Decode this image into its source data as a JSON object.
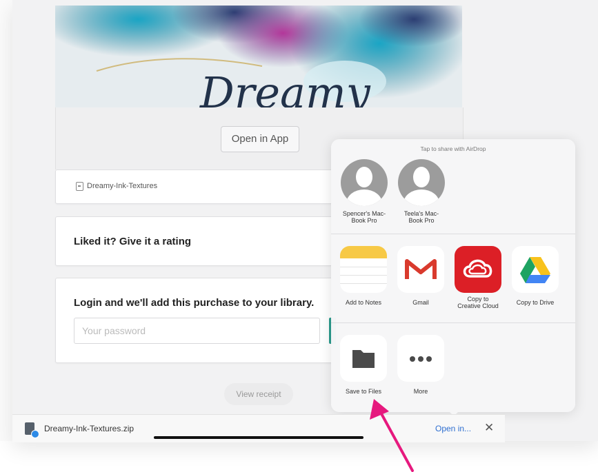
{
  "hero": {
    "art_text": "Dreamy"
  },
  "product": {
    "open_button": "Open in App",
    "file_name": "Dreamy-Ink-Textures"
  },
  "rating": {
    "title": "Liked it? Give it a rating"
  },
  "login": {
    "title": "Login and we'll add this purchase to your library.",
    "password_placeholder": "Your password"
  },
  "receipt": {
    "label": "View receipt"
  },
  "share": {
    "airdrop_title": "Tap to share with AirDrop",
    "devices": [
      {
        "name_line1": "Spencer's Mac-",
        "name_line2": "Book Pro"
      },
      {
        "name_line1": "Teela's Mac-",
        "name_line2": "Book Pro"
      }
    ],
    "apps": [
      {
        "label": "Add to Notes",
        "icon": "notes-icon"
      },
      {
        "label": "Gmail",
        "icon": "gmail-icon"
      },
      {
        "label_line1": "Copy to",
        "label_line2": "Creative Cloud",
        "icon": "creative-cloud-icon"
      },
      {
        "label": "Copy to Drive",
        "icon": "google-drive-icon"
      }
    ],
    "actions": [
      {
        "label": "Save to Files",
        "icon": "folder-icon"
      },
      {
        "label": "More",
        "icon": "more-icon"
      }
    ]
  },
  "download_bar": {
    "file_name": "Dreamy-Ink-Textures.zip",
    "open_in": "Open in...",
    "close": "✕"
  },
  "colors": {
    "annotation_arrow": "#e6197e",
    "link": "#2f6fd0",
    "creative_cloud": "#dc1f26"
  }
}
